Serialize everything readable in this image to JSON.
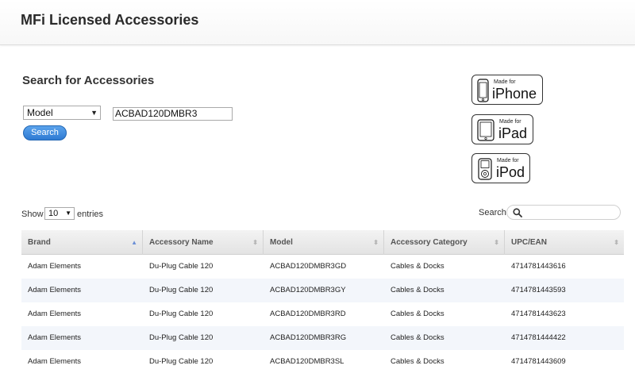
{
  "header": {
    "title": "MFi Licensed Accessories"
  },
  "search": {
    "title": "Search for Accessories",
    "field_select": "Model",
    "query_value": "ACBAD120DMBR3",
    "button_label": "Search"
  },
  "badges": [
    {
      "made_for": "Made for",
      "device": "iPhone"
    },
    {
      "made_for": "Made for",
      "device": "iPad"
    },
    {
      "made_for": "Made for",
      "device": "iPod"
    }
  ],
  "table_controls": {
    "show_label": "Show",
    "page_size": "10",
    "entries_label": "entries",
    "search_label": "Search:"
  },
  "table": {
    "columns": [
      "Brand",
      "Accessory Name",
      "Model",
      "Accessory Category",
      "UPC/EAN"
    ],
    "rows": [
      [
        "Adam Elements",
        "Du-Plug Cable 120",
        "ACBAD120DMBR3GD",
        "Cables & Docks",
        "4714781443616"
      ],
      [
        "Adam Elements",
        "Du-Plug Cable 120",
        "ACBAD120DMBR3GY",
        "Cables & Docks",
        "4714781443593"
      ],
      [
        "Adam Elements",
        "Du-Plug Cable 120",
        "ACBAD120DMBR3RD",
        "Cables & Docks",
        "4714781443623"
      ],
      [
        "Adam Elements",
        "Du-Plug Cable 120",
        "ACBAD120DMBR3RG",
        "Cables & Docks",
        "4714781444422"
      ],
      [
        "Adam Elements",
        "Du-Plug Cable 120",
        "ACBAD120DMBR3SL",
        "Cables & Docks",
        "4714781443609"
      ]
    ]
  },
  "colors": {
    "accent": "#2e7ad3",
    "row_alt": "#f3f6fb"
  }
}
